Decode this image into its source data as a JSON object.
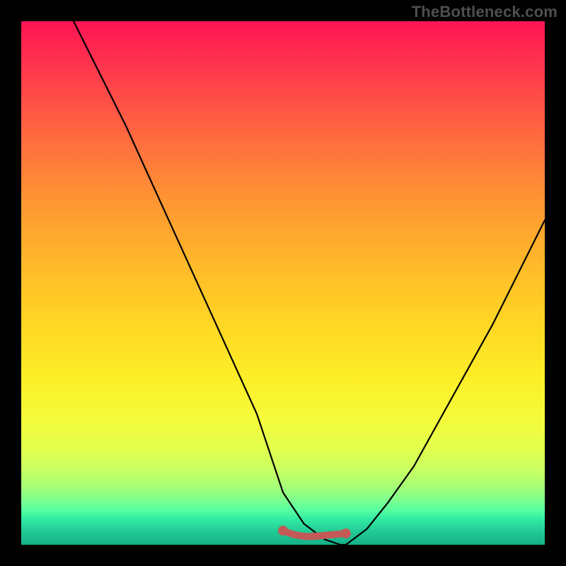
{
  "attribution": "TheBottleneck.com",
  "chart_data": {
    "type": "line",
    "title": "",
    "xlabel": "",
    "ylabel": "",
    "xlim": [
      0,
      100
    ],
    "ylim": [
      0,
      100
    ],
    "grid": false,
    "legend": false,
    "series": [
      {
        "name": "bottleneck-curve",
        "x": [
          10,
          15,
          20,
          25,
          30,
          35,
          40,
          45,
          48,
          50,
          54,
          58,
          61,
          62,
          66,
          70,
          75,
          80,
          85,
          90,
          95,
          100
        ],
        "y": [
          100,
          90,
          80,
          69,
          58,
          47,
          36,
          25,
          16,
          10,
          4,
          1,
          0,
          0,
          3,
          8,
          15,
          24,
          33,
          42,
          52,
          62
        ]
      }
    ],
    "trough_marker": {
      "name": "optimal-range",
      "x_start": 50,
      "x_end": 62,
      "y": 0
    },
    "background_gradient": {
      "top": "#ff1454",
      "bottom": "#16b089",
      "meaning_top": "high-bottleneck",
      "meaning_bottom": "no-bottleneck"
    }
  }
}
